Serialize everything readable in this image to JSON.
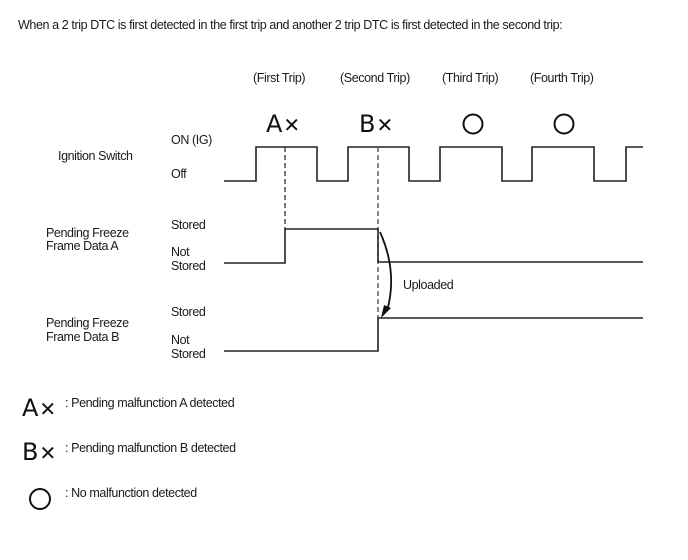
{
  "caption": "When a 2 trip DTC is first detected in the first trip and another 2 trip DTC is first detected in the second trip:",
  "trips": [
    {
      "label": "(First Trip)",
      "marker": "AX",
      "marker_meaning": "pending-a"
    },
    {
      "label": "(Second Trip)",
      "marker": "BX",
      "marker_meaning": "pending-b"
    },
    {
      "label": "(Third Trip)",
      "marker": "O",
      "marker_meaning": "no-malfunction"
    },
    {
      "label": "(Fourth Trip)",
      "marker": "O",
      "marker_meaning": "no-malfunction"
    }
  ],
  "signals": {
    "ignition": {
      "name": "Ignition Switch",
      "high_label": "ON (IG)",
      "low_label": "Off",
      "states": [
        "Off",
        "ON (IG)",
        "Off",
        "ON (IG)",
        "Off",
        "ON (IG)",
        "Off",
        "ON (IG)",
        "Off",
        "ON (IG)"
      ]
    },
    "freeze_a": {
      "name_line1": "Pending Freeze",
      "name_line2": "Frame Data A",
      "high_label": "Stored",
      "low_label_line1": "Not",
      "low_label_line2": "Stored",
      "states": [
        "Not Stored",
        "Stored (from first-trip detection)",
        "Not Stored (after second-trip detection)"
      ]
    },
    "freeze_b": {
      "name_line1": "Pending Freeze",
      "name_line2": "Frame Data B",
      "high_label": "Stored",
      "low_label_line1": "Not",
      "low_label_line2": "Stored",
      "states": [
        "Not Stored",
        "Stored (from second-trip detection)"
      ]
    }
  },
  "annotation": {
    "uploaded": "Uploaded"
  },
  "legend": [
    {
      "symbol": "AX",
      "text": ": Pending malfunction A detected"
    },
    {
      "symbol": "BX",
      "text": ": Pending malfunction B detected"
    },
    {
      "symbol": "O",
      "text": ": No malfunction detected"
    }
  ]
}
